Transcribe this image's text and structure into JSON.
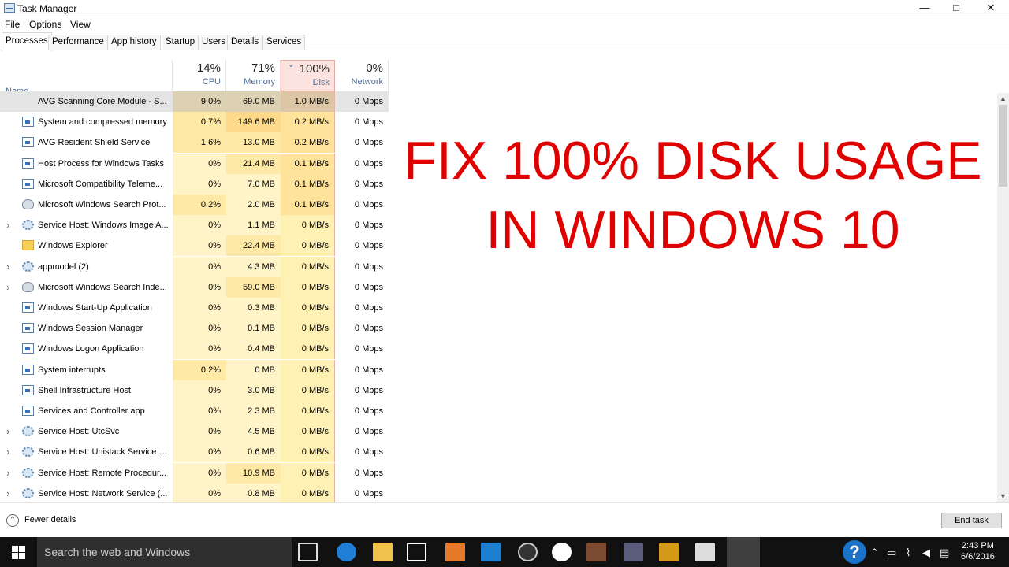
{
  "window": {
    "title": "Task Manager",
    "minimize": "—",
    "maximize": "□",
    "close": "✕"
  },
  "menu": [
    "File",
    "Options",
    "View"
  ],
  "tabs": [
    "Processes",
    "Performance",
    "App history",
    "Startup",
    "Users",
    "Details",
    "Services"
  ],
  "columns": {
    "name": "Name",
    "cpu_pct": "14%",
    "cpu": "CPU",
    "mem_pct": "71%",
    "mem": "Memory",
    "disk_pct": "100%",
    "disk": "Disk",
    "net_pct": "0%",
    "net": "Network"
  },
  "rows": [
    {
      "name": "AVG Scanning Core Module - S...",
      "cpu": "9.0%",
      "mem": "69.0 MB",
      "disk": "1.0 MB/s",
      "net": "0 Mbps",
      "icon": "app-icon",
      "expand": false
    },
    {
      "name": "System and compressed memory",
      "cpu": "0.7%",
      "mem": "149.6 MB",
      "disk": "0.2 MB/s",
      "net": "0 Mbps",
      "icon": "app-icon",
      "expand": false
    },
    {
      "name": "AVG Resident Shield Service",
      "cpu": "1.6%",
      "mem": "13.0 MB",
      "disk": "0.2 MB/s",
      "net": "0 Mbps",
      "icon": "app-icon",
      "expand": false
    },
    {
      "name": "Host Process for Windows Tasks",
      "cpu": "0%",
      "mem": "21.4 MB",
      "disk": "0.1 MB/s",
      "net": "0 Mbps",
      "icon": "app-icon",
      "expand": false
    },
    {
      "name": "Microsoft Compatibility Teleme...",
      "cpu": "0%",
      "mem": "7.0 MB",
      "disk": "0.1 MB/s",
      "net": "0 Mbps",
      "icon": "app-icon",
      "expand": false
    },
    {
      "name": "Microsoft Windows Search Prot...",
      "cpu": "0.2%",
      "mem": "2.0 MB",
      "disk": "0.1 MB/s",
      "net": "0 Mbps",
      "icon": "user-icon",
      "expand": false
    },
    {
      "name": "Service Host: Windows Image A...",
      "cpu": "0%",
      "mem": "1.1 MB",
      "disk": "0 MB/s",
      "net": "0 Mbps",
      "icon": "gear-icon",
      "expand": true
    },
    {
      "name": "Windows Explorer",
      "cpu": "0%",
      "mem": "22.4 MB",
      "disk": "0 MB/s",
      "net": "0 Mbps",
      "icon": "folder-icon",
      "expand": false
    },
    {
      "name": "appmodel (2)",
      "cpu": "0%",
      "mem": "4.3 MB",
      "disk": "0 MB/s",
      "net": "0 Mbps",
      "icon": "gear-icon",
      "expand": true
    },
    {
      "name": "Microsoft Windows Search Inde...",
      "cpu": "0%",
      "mem": "59.0 MB",
      "disk": "0 MB/s",
      "net": "0 Mbps",
      "icon": "user-icon",
      "expand": true
    },
    {
      "name": "Windows Start-Up Application",
      "cpu": "0%",
      "mem": "0.3 MB",
      "disk": "0 MB/s",
      "net": "0 Mbps",
      "icon": "app-icon",
      "expand": false
    },
    {
      "name": "Windows Session Manager",
      "cpu": "0%",
      "mem": "0.1 MB",
      "disk": "0 MB/s",
      "net": "0 Mbps",
      "icon": "app-icon",
      "expand": false
    },
    {
      "name": "Windows Logon Application",
      "cpu": "0%",
      "mem": "0.4 MB",
      "disk": "0 MB/s",
      "net": "0 Mbps",
      "icon": "app-icon",
      "expand": false
    },
    {
      "name": "System interrupts",
      "cpu": "0.2%",
      "mem": "0 MB",
      "disk": "0 MB/s",
      "net": "0 Mbps",
      "icon": "app-icon",
      "expand": false
    },
    {
      "name": "Shell Infrastructure Host",
      "cpu": "0%",
      "mem": "3.0 MB",
      "disk": "0 MB/s",
      "net": "0 Mbps",
      "icon": "app-icon",
      "expand": false
    },
    {
      "name": "Services and Controller app",
      "cpu": "0%",
      "mem": "2.3 MB",
      "disk": "0 MB/s",
      "net": "0 Mbps",
      "icon": "app-icon",
      "expand": false
    },
    {
      "name": "Service Host: UtcSvc",
      "cpu": "0%",
      "mem": "4.5 MB",
      "disk": "0 MB/s",
      "net": "0 Mbps",
      "icon": "gear-icon",
      "expand": true
    },
    {
      "name": "Service Host: Unistack Service G...",
      "cpu": "0%",
      "mem": "0.6 MB",
      "disk": "0 MB/s",
      "net": "0 Mbps",
      "icon": "gear-icon",
      "expand": true
    },
    {
      "name": "Service Host: Remote Procedur...",
      "cpu": "0%",
      "mem": "10.9 MB",
      "disk": "0 MB/s",
      "net": "0 Mbps",
      "icon": "gear-icon",
      "expand": true
    },
    {
      "name": "Service Host: Network Service (...",
      "cpu": "0%",
      "mem": "0.8 MB",
      "disk": "0 MB/s",
      "net": "0 Mbps",
      "icon": "gear-icon",
      "expand": true
    }
  ],
  "overlay": {
    "line1": "FIX 100% DISK USAGE",
    "line2": "IN WINDOWS 10"
  },
  "footer": {
    "fewer_details": "Fewer details",
    "end_task": "End task"
  },
  "taskbar": {
    "search_placeholder": "Search the web and Windows",
    "time": "2:43 PM",
    "date": "6/6/2016"
  }
}
